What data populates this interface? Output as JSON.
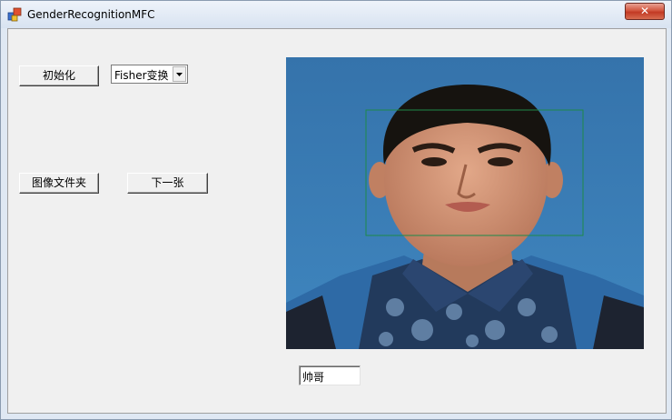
{
  "window": {
    "title": "GenderRecognitionMFC",
    "close_label": "✕"
  },
  "controls": {
    "init_button": "初始化",
    "method_select": {
      "selected": "Fisher变换"
    },
    "image_folder_button": "图像文件夹",
    "next_button": "下一张",
    "result_field": {
      "value": "帅哥"
    }
  },
  "colors": {
    "face_box": "#1e8a4a",
    "photo_background": "#3f7fb3"
  }
}
